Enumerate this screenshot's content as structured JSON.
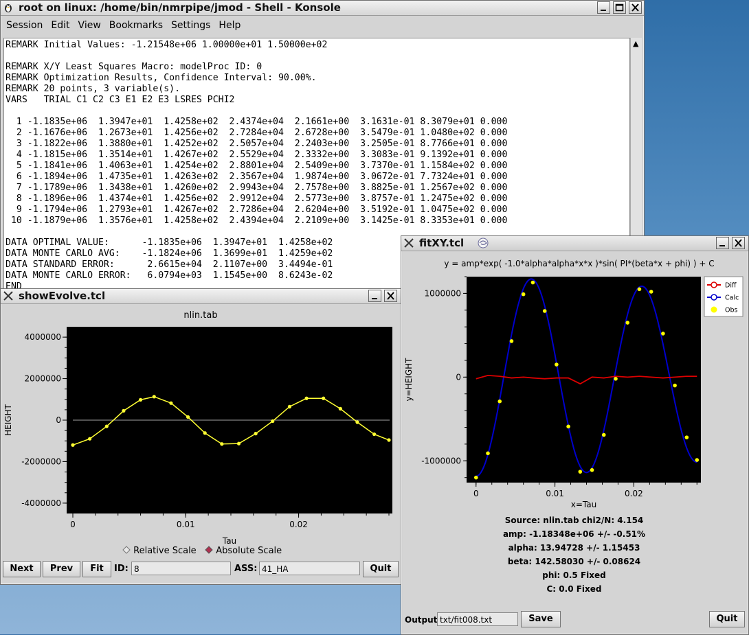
{
  "konsole": {
    "title": "root on linux: /home/bin/nmrpipe/jmod - Shell - Konsole",
    "menu": [
      "Session",
      "Edit",
      "View",
      "Bookmarks",
      "Settings",
      "Help"
    ],
    "lines": [
      "REMARK Initial Values: -1.21548e+06 1.00000e+01 1.50000e+02",
      "",
      "REMARK X/Y Least Squares Macro: modelProc ID: 0",
      "REMARK Optimization Results, Confidence Interval: 90.00%.",
      "REMARK 20 points, 3 variable(s).",
      "VARS   TRIAL C1 C2 C3 E1 E2 E3 LSRES PCHI2",
      "",
      "  1 -1.1835e+06  1.3947e+01  1.4258e+02  2.4374e+04  2.1661e+00  3.1631e-01 8.3079e+01 0.000",
      "  2 -1.1676e+06  1.2673e+01  1.4256e+02  2.7284e+04  2.6728e+00  3.5479e-01 1.0480e+02 0.000",
      "  3 -1.1822e+06  1.3880e+01  1.4252e+02  2.5057e+04  2.2403e+00  3.2505e-01 8.7766e+01 0.000",
      "  4 -1.1815e+06  1.3514e+01  1.4267e+02  2.5529e+04  2.3332e+00  3.3083e-01 9.1392e+01 0.000",
      "  5 -1.1841e+06  1.4063e+01  1.4254e+02  2.8801e+04  2.5409e+00  3.7370e-01 1.1584e+02 0.000",
      "  6 -1.1894e+06  1.4735e+01  1.4263e+02  2.3567e+04  1.9874e+00  3.0672e-01 7.7324e+01 0.000",
      "  7 -1.1789e+06  1.3438e+01  1.4260e+02  2.9943e+04  2.7578e+00  3.8825e-01 1.2567e+02 0.000",
      "  8 -1.1896e+06  1.4374e+01  1.4256e+02  2.9912e+04  2.5773e+00  3.8757e-01 1.2475e+02 0.000",
      "  9 -1.1794e+06  1.2793e+01  1.4267e+02  2.7286e+04  2.6204e+00  3.5192e-01 1.0475e+02 0.000",
      " 10 -1.1879e+06  1.3576e+01  1.4258e+02  2.4394e+04  2.2109e+00  3.1425e-01 8.3353e+01 0.000",
      "",
      "DATA OPTIMAL VALUE:      -1.1835e+06  1.3947e+01  1.4258e+02",
      "DATA MONTE CARLO AVG:    -1.1824e+06  1.3699e+01  1.4259e+02",
      "DATA STANDARD ERROR:      2.6615e+04  2.1107e+00  3.4494e-01",
      "DATA MONTE CARLO ERROR:   6.0794e+03  1.1545e+00  8.6243e-02",
      "END"
    ]
  },
  "evolve": {
    "title": "showEvolve.tcl",
    "plot_title": "nlin.tab",
    "xlabel": "Tau",
    "ylabel": "HEIGHT",
    "yticks": [
      "4000000",
      "2000000",
      "0",
      "-2000000",
      "-4000000"
    ],
    "xticks": [
      "0",
      "0.01",
      "0.02"
    ],
    "relative_scale": "Relative Scale",
    "absolute_scale": "Absolute Scale",
    "buttons": {
      "next": "Next",
      "prev": "Prev",
      "fit": "Fit",
      "quit": "Quit"
    },
    "id_label": "ID:",
    "id_value": "8",
    "ass_label": "ASS:",
    "ass_value": "41_HA"
  },
  "fitxy": {
    "title": "fitXY.tcl",
    "equation": "y = amp*exp( -1.0*alpha*alpha*x*x )*sin( PI*(beta*x + phi) ) + C",
    "xlabel": "x=Tau",
    "ylabel": "y=HEIGHT",
    "yticks": [
      "1000000",
      "0",
      "-1000000"
    ],
    "xticks": [
      "0",
      "0.01",
      "0.02"
    ],
    "legend": [
      "Diff",
      "Calc",
      "Obs"
    ],
    "info": [
      "Source: nlin.tab chi2/N: 4.154",
      "amp: -1.18348e+06 +/- -0.51%",
      "alpha: 13.94728 +/- 1.15453",
      "beta: 142.58030 +/- 0.08624",
      "phi: 0.5 Fixed",
      "C: 0.0 Fixed"
    ],
    "output_label": "Output:",
    "output_value": "txt/fit008.txt",
    "save": "Save",
    "quit": "Quit"
  },
  "colors": {
    "plot_bg": "#000000",
    "evolve_line": "#ffff33",
    "calc": "#0000cc",
    "diff": "#dd0000",
    "obs": "#ffff00"
  },
  "chart_data": [
    {
      "type": "line",
      "title": "nlin.tab",
      "xlabel": "Tau",
      "ylabel": "HEIGHT",
      "xlim": [
        0,
        0.028
      ],
      "ylim": [
        -4500000,
        4500000
      ],
      "x": [
        0,
        0.0015,
        0.003,
        0.0045,
        0.006,
        0.0072,
        0.0087,
        0.0102,
        0.0117,
        0.0132,
        0.0147,
        0.0162,
        0.0177,
        0.0192,
        0.0207,
        0.0222,
        0.0237,
        0.0252,
        0.0267,
        0.028
      ],
      "series": [
        {
          "values": [
            -1200000,
            -900000,
            -300000,
            450000,
            980000,
            1130000,
            820000,
            150000,
            -620000,
            -1150000,
            -1130000,
            -650000,
            -50000,
            650000,
            1050000,
            1050000,
            550000,
            -100000,
            -680000,
            -960000
          ]
        }
      ]
    },
    {
      "type": "line",
      "title": "y = amp*exp( -1.0*alpha*alpha*x*x )*sin( PI*(beta*x + phi) ) + C",
      "xlabel": "x=Tau",
      "ylabel": "y=HEIGHT",
      "xlim": [
        -0.0012,
        0.0285
      ],
      "ylim": [
        -1260000,
        1200000
      ],
      "x": [
        0,
        0.0015,
        0.003,
        0.0045,
        0.006,
        0.0072,
        0.0087,
        0.0102,
        0.0117,
        0.0132,
        0.0147,
        0.0162,
        0.0177,
        0.0192,
        0.0207,
        0.0222,
        0.0237,
        0.0252,
        0.0267,
        0.028
      ],
      "series": [
        {
          "name": "Obs",
          "values": [
            -1200000,
            -910000,
            -290000,
            430000,
            990000,
            1130000,
            790000,
            150000,
            -590000,
            -1130000,
            -1110000,
            -690000,
            -20000,
            650000,
            1050000,
            1020000,
            520000,
            -100000,
            -720000,
            -990000
          ]
        },
        {
          "name": "Diff",
          "values": [
            -20000,
            20000,
            10000,
            -10000,
            0,
            -10000,
            -20000,
            -10000,
            -10000,
            -80000,
            0,
            -10000,
            10000,
            0,
            10000,
            0,
            -10000,
            0,
            10000,
            10000
          ]
        }
      ],
      "calc_params": {
        "amp": -1183480,
        "alpha": 13.94728,
        "beta": 142.5803,
        "phi": 0.5,
        "C": 0
      }
    }
  ]
}
